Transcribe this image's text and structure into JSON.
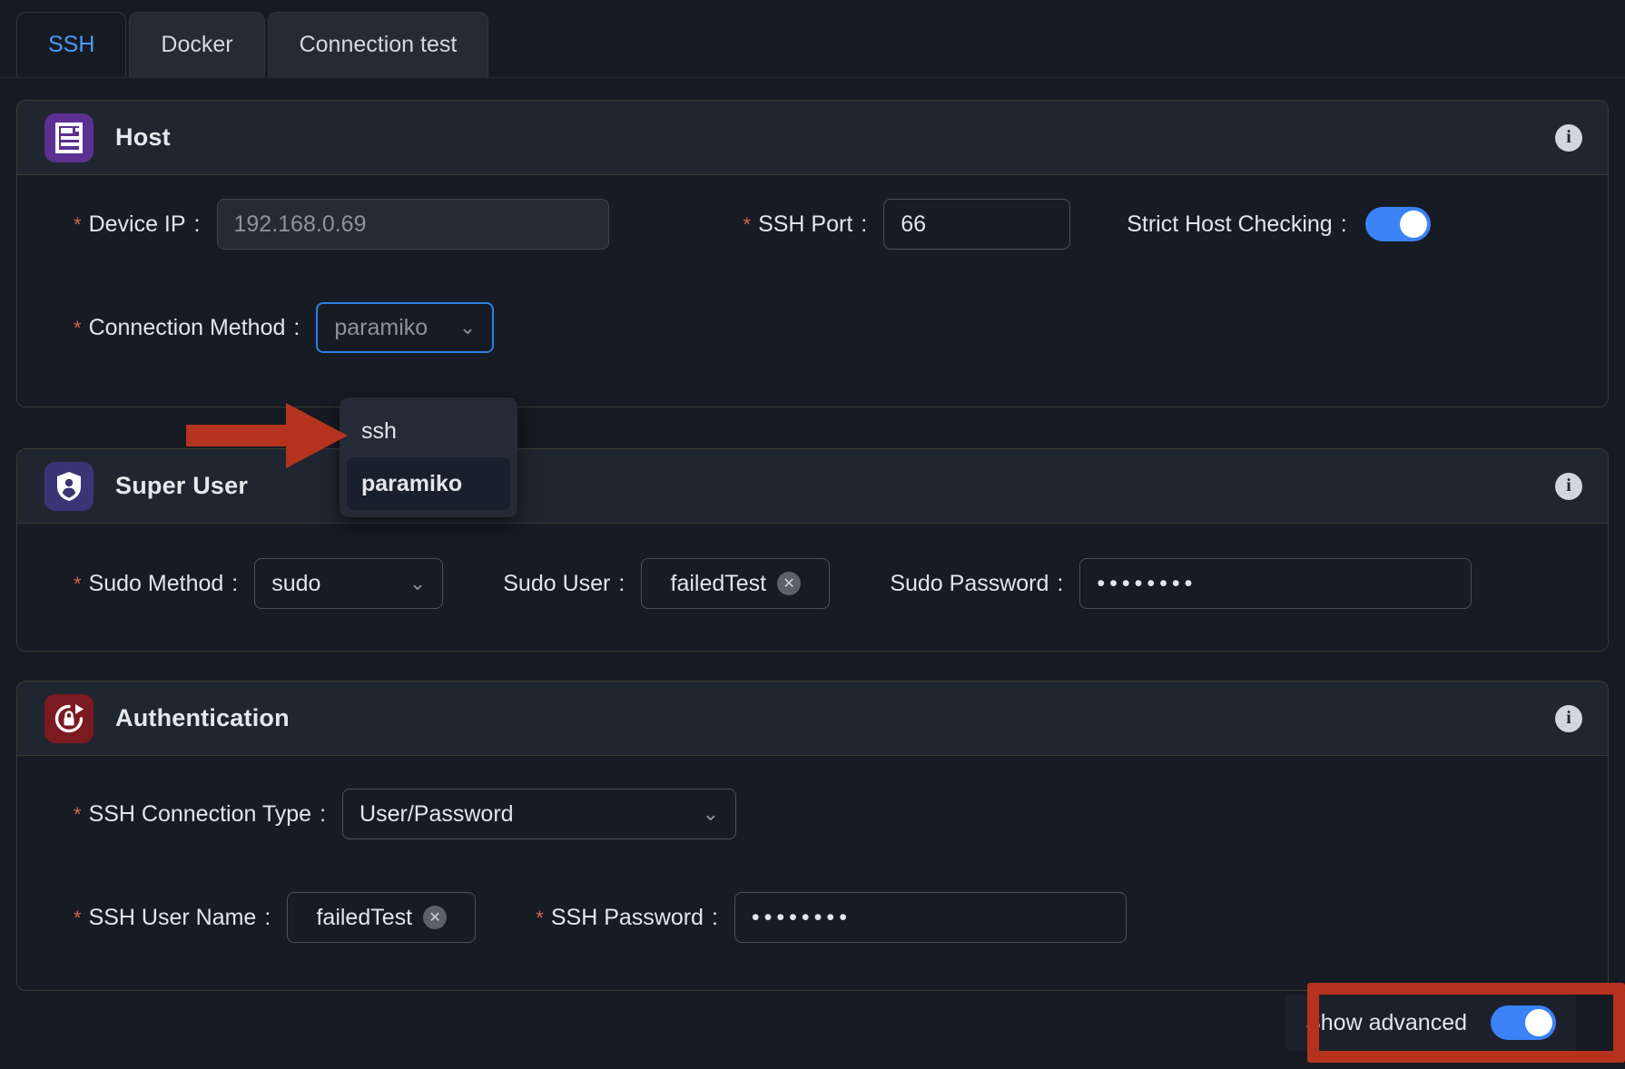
{
  "tabs": [
    {
      "label": "SSH",
      "active": true
    },
    {
      "label": "Docker",
      "active": false
    },
    {
      "label": "Connection test",
      "active": false
    }
  ],
  "colors": {
    "accent_blue": "#3b82f6",
    "focus_blue": "#2f7fe8",
    "annotation_red": "#b5331e",
    "required_star": "#d9604e",
    "host_icon_bg": "#5b3091",
    "superuser_icon_bg": "#3b3575",
    "auth_icon_bg": "#7b1a20",
    "page_bg": "#161a22",
    "panel_bg": "#1b202a",
    "panel_header_bg": "#20262f"
  },
  "sections": {
    "host": {
      "title": "Host",
      "icon": "server-icon",
      "info_icon": "info-icon",
      "device_ip": {
        "label": "Device IP",
        "required": true,
        "value": "",
        "placeholder": "192.168.0.69"
      },
      "ssh_port": {
        "label": "SSH Port",
        "required": true,
        "value": "66"
      },
      "strict_host_checking": {
        "label": "Strict Host Checking",
        "required": false,
        "state": "on"
      },
      "connection_method": {
        "label": "Connection Method",
        "required": true,
        "value": "paramiko",
        "focused": true,
        "chevron": "chevron-down-icon",
        "open": true,
        "options": [
          {
            "label": "ssh",
            "selected": false
          },
          {
            "label": "paramiko",
            "selected": true
          }
        ]
      }
    },
    "super_user": {
      "title": "Super User",
      "icon": "shield-user-icon",
      "info_icon": "info-icon",
      "sudo_method": {
        "label": "Sudo Method",
        "required": true,
        "value": "sudo",
        "chevron": "chevron-down-icon"
      },
      "sudo_user": {
        "label": "Sudo User",
        "required": false,
        "value": "failedTest",
        "clear_icon": "clear-x-icon"
      },
      "sudo_password": {
        "label": "Sudo Password",
        "required": false,
        "value": "••••••••"
      }
    },
    "authentication": {
      "title": "Authentication",
      "icon": "lock-refresh-icon",
      "info_icon": "info-icon",
      "ssh_connection_type": {
        "label": "SSH Connection Type",
        "required": true,
        "value": "User/Password",
        "chevron": "chevron-down-icon"
      },
      "ssh_user_name": {
        "label": "SSH User Name",
        "required": true,
        "value": "failedTest",
        "clear_icon": "clear-x-icon"
      },
      "ssh_password": {
        "label": "SSH Password",
        "required": true,
        "value": "••••••••"
      }
    }
  },
  "footer": {
    "show_advanced": {
      "label": "Show advanced",
      "state": "on"
    }
  },
  "annotations": {
    "arrow": {
      "target": "connection-method-dropdown-option-ssh",
      "color": "#b5331e"
    },
    "box": {
      "target": "show-advanced-toggle-group",
      "color": "#b5331e"
    }
  }
}
